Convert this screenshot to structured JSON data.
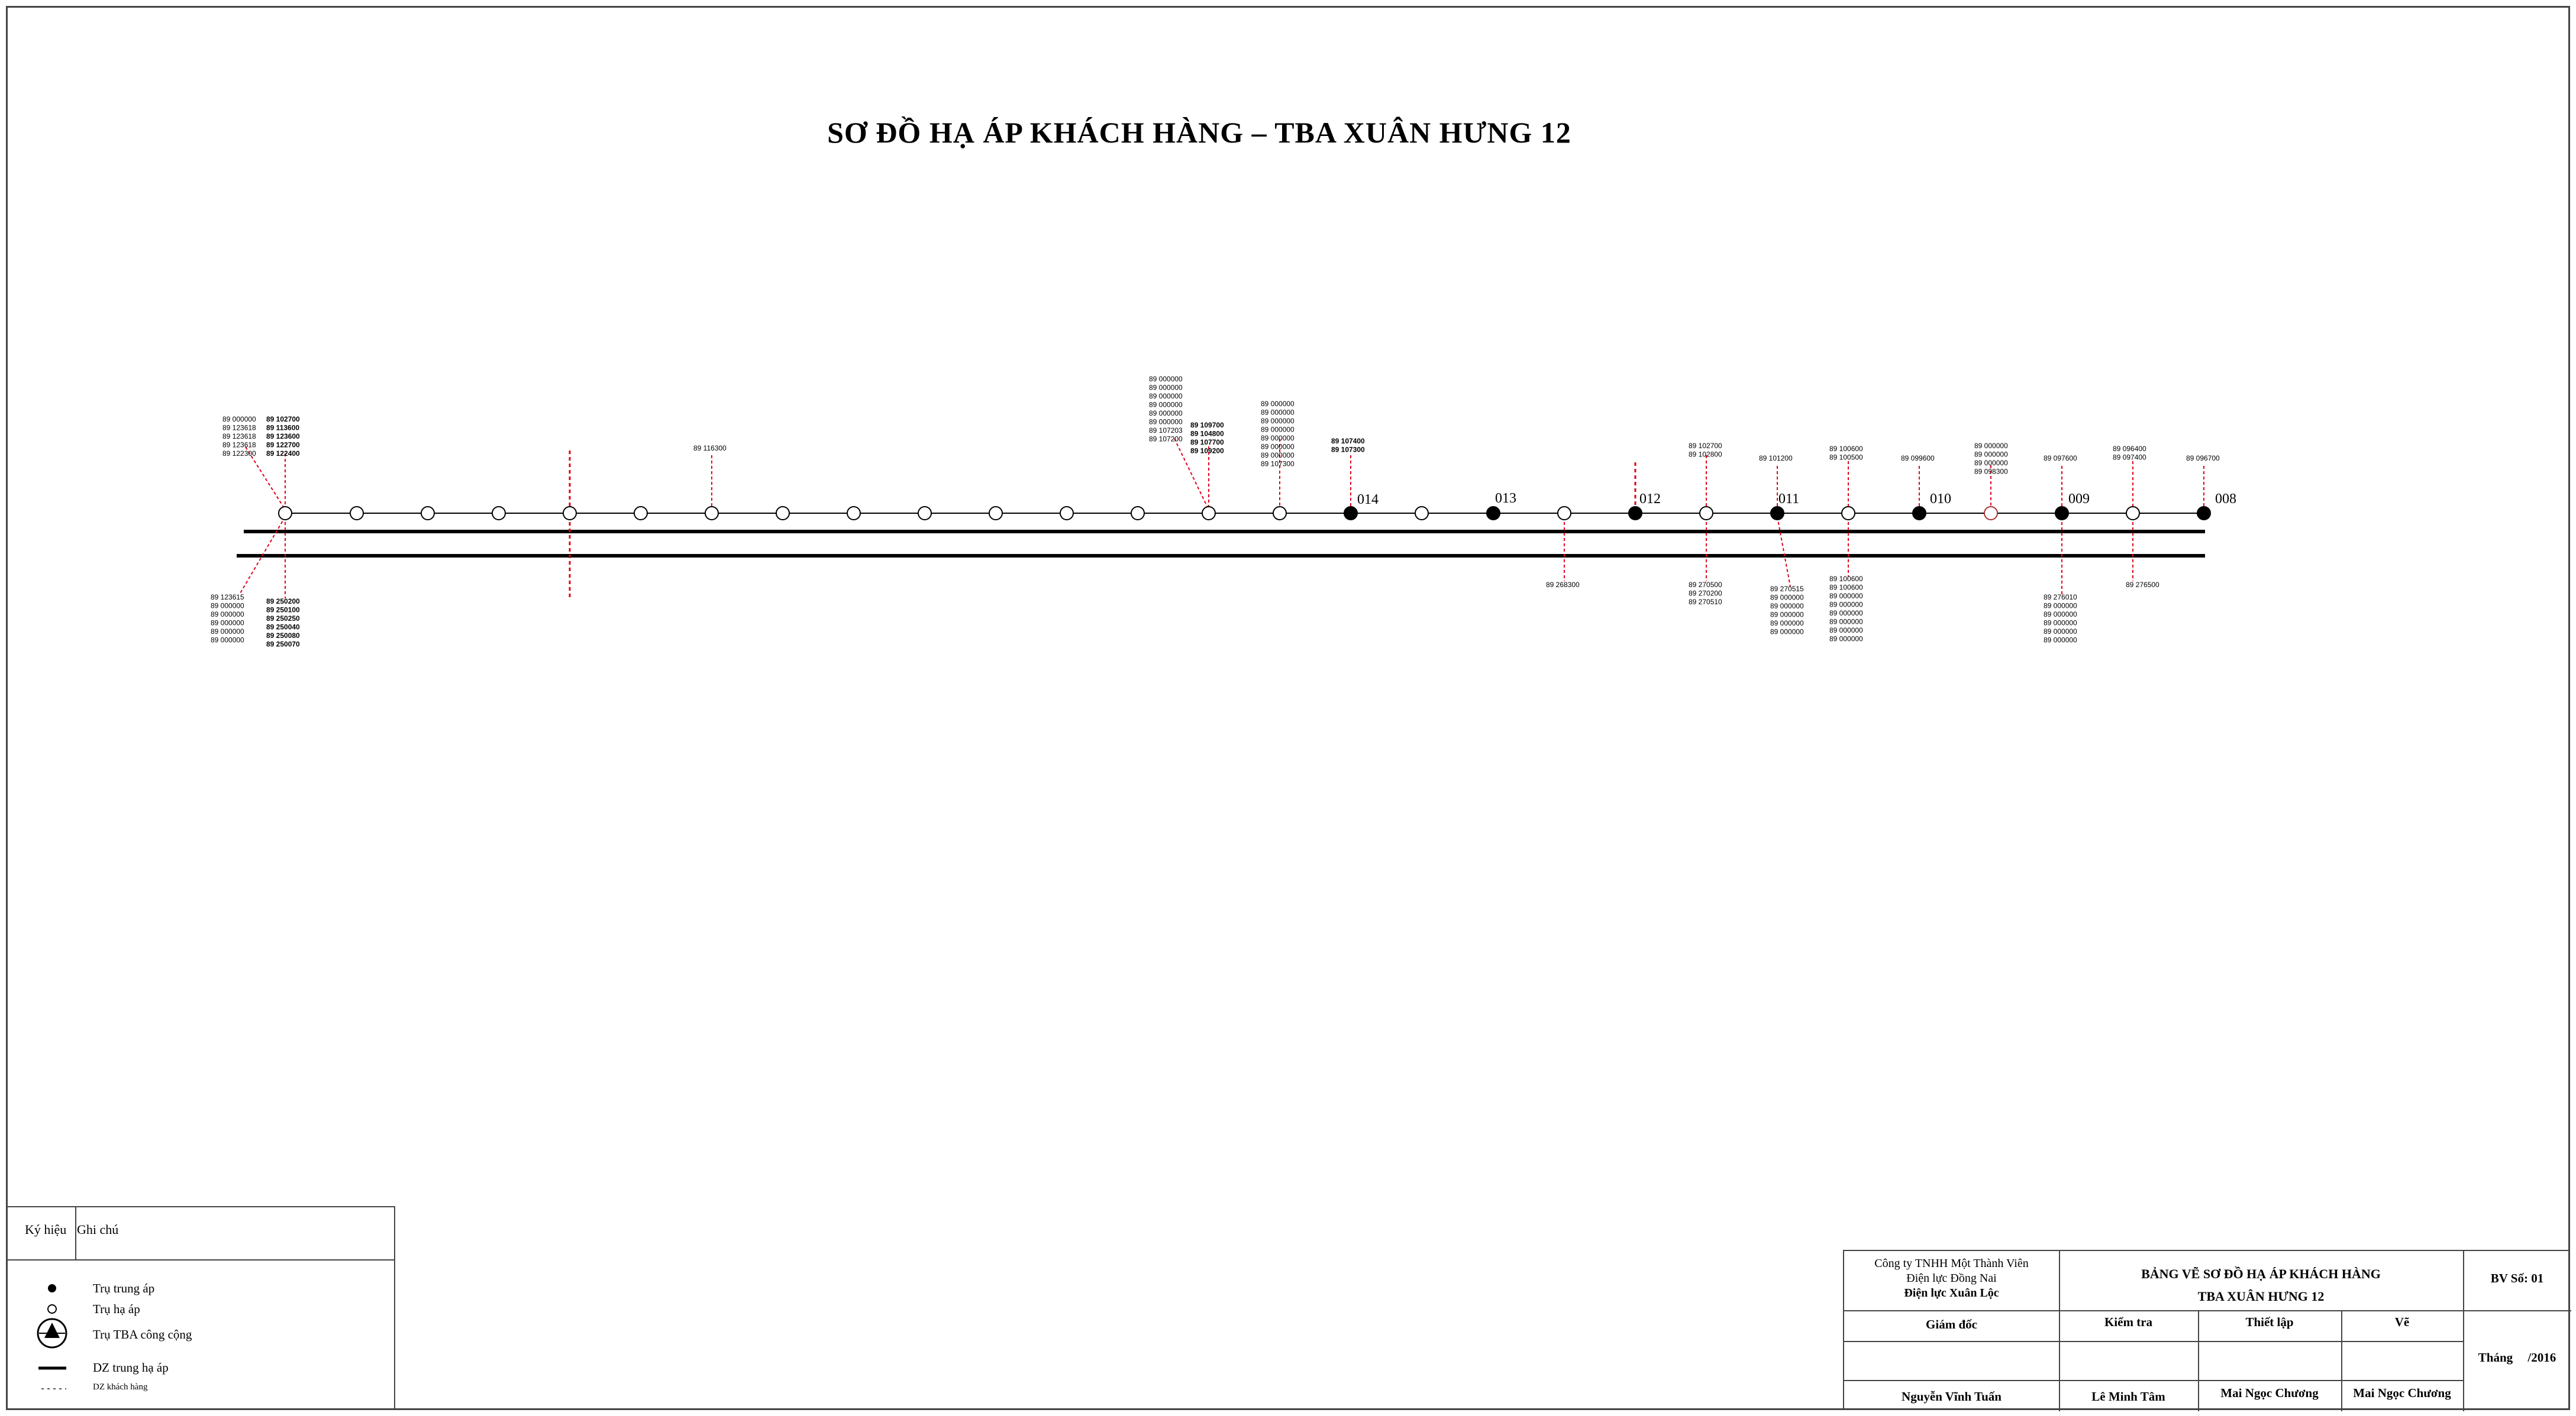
{
  "title": "SƠ ĐỒ HẠ ÁP KHÁCH HÀNG – TBA XUÂN HƯNG 12",
  "pole_numbers": [
    "014",
    "013",
    "012",
    "011",
    "010",
    "009",
    "008"
  ],
  "customer_labels": {
    "l1": [
      "89 000000",
      "89 123618",
      "89 123618",
      "89 123618",
      "89 122300"
    ],
    "l2": [
      "89 102700",
      "89 113600",
      "89 123600",
      "89 122700",
      "89 122400"
    ],
    "l3": [
      "89 116300"
    ],
    "l4": [
      "89 000000",
      "89 000000",
      "89 000000",
      "89 000000",
      "89 000000",
      "89 000000",
      "89 107203",
      "89 107200"
    ],
    "l5": [
      "89 109700",
      "89 104800",
      "89 107700",
      "89 109200"
    ],
    "l6": [
      "89 000000",
      "89 000000",
      "89 000000",
      "89 000000",
      "89 000000",
      "89 000000",
      "89 000000",
      "89 107300"
    ],
    "l7": [
      "89 107400",
      "89 107300"
    ],
    "l8": [
      "89 102700",
      "89 102800"
    ],
    "l9": [
      "89 101200"
    ],
    "l10": [
      "89 100600",
      "89 100500"
    ],
    "l11": [
      "89 099600"
    ],
    "l12": [
      "89 000000",
      "89 000000",
      "89 000000",
      "89 098300"
    ],
    "l13": [
      "89 097600"
    ],
    "l14": [
      "89 096400",
      "89 097400"
    ],
    "l15": [
      "89 096700"
    ],
    "b1": [
      "89 123615",
      "89 000000",
      "89 000000",
      "89 000000",
      "89 000000",
      "89 000000"
    ],
    "b2": [
      "89 250200",
      "89 250100",
      "89 250250",
      "89 250040",
      "89 250080",
      "89 250070"
    ],
    "b3": [
      "89 268300"
    ],
    "b4": [
      "89 270500",
      "89 270200",
      "89 270510"
    ],
    "b5": [
      "89 270515",
      "89 000000",
      "89 000000",
      "89 000000",
      "89 000000",
      "89 000000"
    ],
    "b6": [
      "89 100600",
      "89 100600",
      "89 000000",
      "89 000000",
      "89 000000",
      "89 000000",
      "89 000000",
      "89 000000"
    ],
    "b7": [
      "89 276010",
      "89 000000",
      "89 000000",
      "89 000000",
      "89 000000",
      "89 000000"
    ],
    "b8": [
      "89 276500"
    ]
  },
  "legend": {
    "header_symbol": "Ký hiệu",
    "header_note": "Ghi chú",
    "items": [
      {
        "icon": "filled-circle-icon",
        "label": "Trụ trung áp"
      },
      {
        "icon": "open-circle-icon",
        "label": "Trụ hạ áp"
      },
      {
        "icon": "transformer-station-icon",
        "label": "Trụ TBA công cộng"
      },
      {
        "icon": "solid-line-icon",
        "label": "DZ trung hạ áp"
      },
      {
        "icon": "dashed-line-icon",
        "label": "DZ khách hàng"
      }
    ]
  },
  "title_block": {
    "company_line1": "Công ty TNHH Một Thành Viên",
    "company_line2": "Điện lực Đồng Nai",
    "company_line3": "Điện lực Xuân Lộc",
    "drawing_title1": "BẢNG VẼ SƠ ĐỒ HẠ ÁP KHÁCH HÀNG",
    "drawing_title2": "TBA XUÂN HƯNG 12",
    "sheet_no": "BV Số: 01",
    "role_director": "Giám đốc",
    "role_check": "Kiểm tra",
    "role_setup": "Thiết lập",
    "role_draw": "Vẽ",
    "name_director": "Nguyễn Vĩnh Tuấn",
    "name_check": "Lê Minh Tâm",
    "name_setup": "Mai Ngọc Chương",
    "name_draw": "Mai Ngọc Chương",
    "month_label": "Tháng",
    "year_label": "/2016"
  },
  "colors": {
    "line": "#000000",
    "customer_line": "#e0001a",
    "border": "#444444"
  }
}
